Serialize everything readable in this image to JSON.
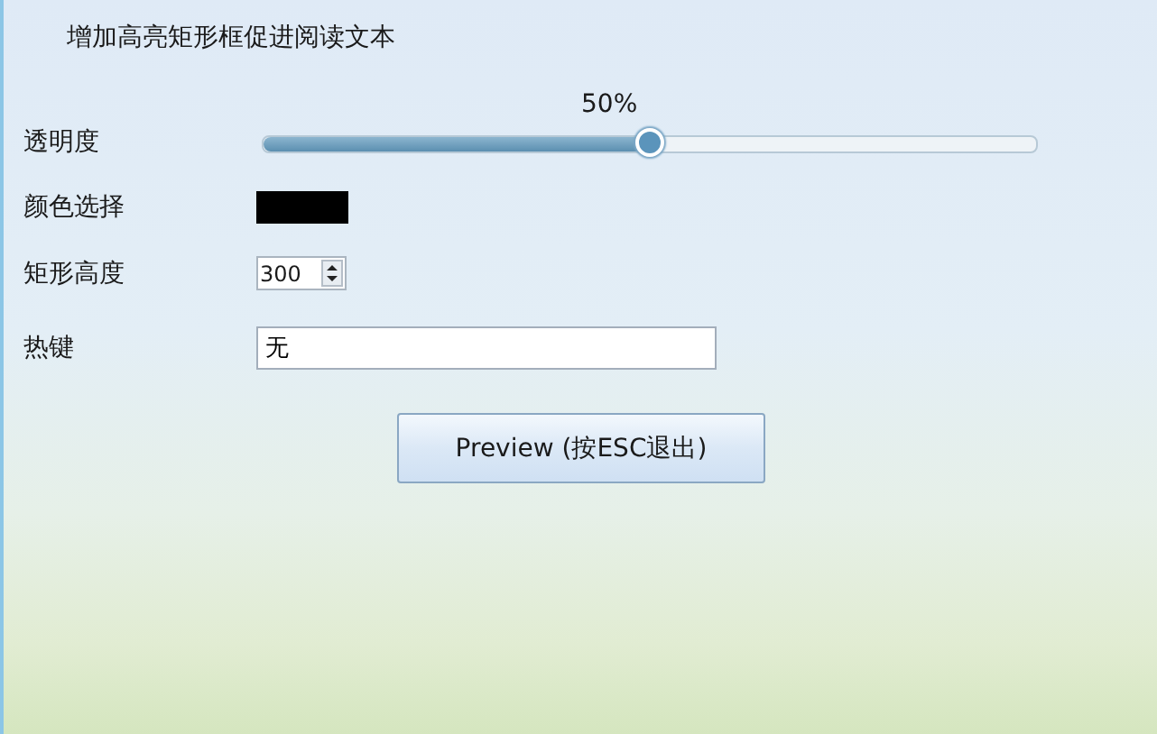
{
  "title": "增加高亮矩形框促进阅读文本",
  "opacity": {
    "label": "透明度",
    "reading": "50%",
    "level": 0.5
  },
  "color_pick": {
    "label": "颜色选择",
    "color": "#000000"
  },
  "rect_height": {
    "label": "矩形高度",
    "value": "300"
  },
  "hotkey": {
    "label": "热键",
    "value": "无"
  },
  "preview_button": "Preview (按ESC退出)"
}
